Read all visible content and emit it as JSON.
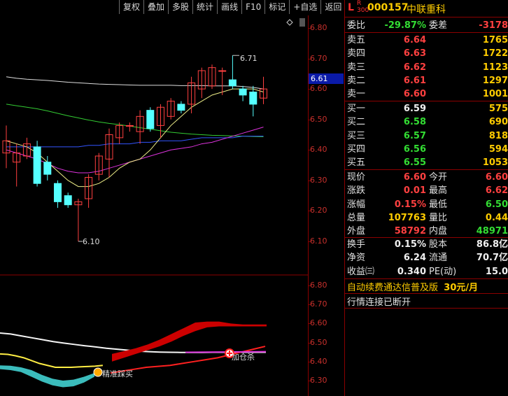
{
  "toolbar": [
    "复权",
    "叠加",
    "多股",
    "统计",
    "画线",
    "F10",
    "标记",
    "+自选",
    "返回"
  ],
  "chart_data": {
    "type": "candlestick",
    "price_ticks": [
      "6.80",
      "6.70",
      "6.60",
      "6.50",
      "6.40",
      "6.30",
      "6.20",
      "6.10"
    ],
    "sub_ticks": [
      "6.80",
      "6.70",
      "6.60",
      "6.50",
      "6.40",
      "6.30"
    ],
    "current_price_label": "6.61",
    "max_label": "6.71",
    "min_label": "6.10",
    "candles": [
      {
        "o": 6.39,
        "c": 6.43,
        "h": 6.48,
        "l": 6.34
      },
      {
        "o": 6.36,
        "c": 6.39,
        "h": 6.42,
        "l": 6.28
      },
      {
        "o": 6.38,
        "c": 6.42,
        "h": 6.44,
        "l": 6.37
      },
      {
        "o": 6.41,
        "c": 6.29,
        "h": 6.43,
        "l": 6.28
      },
      {
        "o": 6.36,
        "c": 6.32,
        "h": 6.38,
        "l": 6.3
      },
      {
        "o": 6.29,
        "c": 6.23,
        "h": 6.3,
        "l": 6.21
      },
      {
        "o": 6.25,
        "c": 6.22,
        "h": 6.26,
        "l": 6.21
      },
      {
        "o": 6.22,
        "c": 6.23,
        "h": 6.24,
        "l": 6.1
      },
      {
        "o": 6.24,
        "c": 6.31,
        "h": 6.32,
        "l": 6.21
      },
      {
        "o": 6.32,
        "c": 6.38,
        "h": 6.39,
        "l": 6.3
      },
      {
        "o": 6.37,
        "c": 6.45,
        "h": 6.47,
        "l": 6.31
      },
      {
        "o": 6.44,
        "c": 6.48,
        "h": 6.49,
        "l": 6.42
      },
      {
        "o": 6.48,
        "c": 6.48,
        "h": 6.49,
        "l": 6.46
      },
      {
        "o": 6.46,
        "c": 6.51,
        "h": 6.53,
        "l": 6.42
      },
      {
        "o": 6.53,
        "c": 6.47,
        "h": 6.54,
        "l": 6.46
      },
      {
        "o": 6.48,
        "c": 6.54,
        "h": 6.55,
        "l": 6.44
      },
      {
        "o": 6.51,
        "c": 6.56,
        "h": 6.57,
        "l": 6.5
      },
      {
        "o": 6.55,
        "c": 6.53,
        "h": 6.56,
        "l": 6.52
      },
      {
        "o": 6.55,
        "c": 6.62,
        "h": 6.64,
        "l": 6.52
      },
      {
        "o": 6.6,
        "c": 6.66,
        "h": 6.67,
        "l": 6.57
      },
      {
        "o": 6.61,
        "c": 6.67,
        "h": 6.68,
        "l": 6.6
      },
      {
        "o": 6.66,
        "c": 6.66,
        "h": 6.67,
        "l": 6.58
      },
      {
        "o": 6.63,
        "c": 6.61,
        "h": 6.71,
        "l": 6.6
      },
      {
        "o": 6.6,
        "c": 6.58,
        "h": 6.61,
        "l": 6.56
      },
      {
        "o": 6.59,
        "c": 6.55,
        "h": 6.61,
        "l": 6.51
      },
      {
        "o": 6.57,
        "c": 6.6,
        "h": 6.64,
        "l": 6.55
      }
    ],
    "ma_white": [
      6.64,
      6.635,
      6.632,
      6.63,
      6.628,
      6.625,
      6.622,
      6.62,
      6.618,
      6.616,
      6.615,
      6.614,
      6.613,
      6.612,
      6.612,
      6.612,
      6.612,
      6.611,
      6.611,
      6.611,
      6.61,
      6.61,
      6.61,
      6.608,
      6.605,
      6.6
    ],
    "ma_green": [
      6.55,
      6.545,
      6.54,
      6.535,
      6.528,
      6.52,
      6.512,
      6.505,
      6.498,
      6.492,
      6.487,
      6.483,
      6.478,
      6.473,
      6.468,
      6.463,
      6.458,
      6.455,
      6.452,
      6.45,
      6.448,
      6.447,
      6.446,
      6.445,
      6.444,
      6.443
    ],
    "ma_magenta": [
      6.4,
      6.39,
      6.38,
      6.37,
      6.355,
      6.34,
      6.33,
      6.325,
      6.325,
      6.33,
      6.34,
      6.35,
      6.36,
      6.37,
      6.38,
      6.39,
      6.4,
      6.405,
      6.41,
      6.42,
      6.425,
      6.435,
      6.445,
      6.455,
      6.465,
      6.475
    ],
    "ma_blue": [
      6.41,
      6.41,
      6.41,
      6.41,
      6.41,
      6.41,
      6.41,
      6.41,
      6.415,
      6.415,
      6.42,
      6.42,
      6.42,
      6.425,
      6.425,
      6.43,
      6.43,
      6.43,
      6.435,
      6.44,
      6.44,
      6.44,
      6.44,
      6.445,
      6.445,
      6.445
    ],
    "ma_yellow": [
      6.43,
      6.42,
      6.41,
      6.39,
      6.36,
      6.33,
      6.3,
      6.28,
      6.28,
      6.29,
      6.31,
      6.34,
      6.36,
      6.37,
      6.4,
      6.44,
      6.48,
      6.51,
      6.54,
      6.56,
      6.58,
      6.59,
      6.6,
      6.6,
      6.6,
      6.59
    ],
    "sub": {
      "white": [
        6.55,
        6.545,
        6.535,
        6.525,
        6.515,
        6.505,
        6.497,
        6.49,
        6.483,
        6.477,
        6.47,
        6.465,
        6.46,
        6.455,
        6.452,
        6.45,
        6.449,
        6.448,
        6.448,
        6.448,
        6.449,
        6.449,
        6.449,
        6.449,
        6.449,
        6.449
      ],
      "yellow": [
        6.44,
        6.438,
        6.43,
        6.42,
        6.405,
        6.39,
        6.38,
        6.37,
        6.37,
        6.37,
        6.372,
        6.374,
        6.376,
        6.38
      ],
      "cyan_top": [
        6.38,
        6.378,
        6.37,
        6.355,
        6.33,
        6.31,
        6.3,
        6.305,
        6.32,
        6.34
      ],
      "cyan_bot": [
        6.36,
        6.355,
        6.345,
        6.32,
        6.295,
        6.275,
        6.265,
        6.27,
        6.29,
        6.32
      ],
      "red_lower": [
        6.34,
        6.35,
        6.36,
        6.37,
        6.375,
        6.38,
        6.39,
        6.4,
        6.41,
        6.42,
        6.435,
        6.45,
        6.465,
        6.48
      ],
      "band_top": [
        6.44,
        6.455,
        6.47,
        6.49,
        6.515,
        6.545,
        6.575,
        6.605,
        6.61,
        6.61,
        6.6,
        6.595,
        6.595,
        6.595
      ],
      "band_bot": [
        6.4,
        6.42,
        6.44,
        6.46,
        6.48,
        6.505,
        6.535,
        6.56,
        6.58,
        6.585,
        6.585,
        6.585,
        6.585,
        6.585
      ]
    },
    "annotations": {
      "buy": "精准踩买",
      "add": "加仓杀"
    }
  },
  "panel": {
    "l": "L",
    "r": "R",
    "r2": "300",
    "code": "000157",
    "name": "中联重科",
    "wei": {
      "lab": "委比",
      "val": "-29.87%",
      "lab2": "委差",
      "val2": "-3178"
    },
    "asks": [
      {
        "lab": "卖五",
        "price": "6.64",
        "vol": "1765"
      },
      {
        "lab": "卖四",
        "price": "6.63",
        "vol": "1722"
      },
      {
        "lab": "卖三",
        "price": "6.62",
        "vol": "1123"
      },
      {
        "lab": "卖二",
        "price": "6.61",
        "vol": "1297"
      },
      {
        "lab": "卖一",
        "price": "6.60",
        "vol": "1001"
      }
    ],
    "bids": [
      {
        "lab": "买一",
        "price": "6.59",
        "vol": "575"
      },
      {
        "lab": "买二",
        "price": "6.58",
        "vol": "690"
      },
      {
        "lab": "买三",
        "price": "6.57",
        "vol": "818"
      },
      {
        "lab": "买四",
        "price": "6.56",
        "vol": "594"
      },
      {
        "lab": "买五",
        "price": "6.55",
        "vol": "1053"
      }
    ],
    "stats": [
      {
        "lab": "现价",
        "val": "6.60",
        "c1": "red",
        "lab2": "今开",
        "val2": "6.60",
        "c2": "red"
      },
      {
        "lab": "涨跌",
        "val": "0.01",
        "c1": "red",
        "lab2": "最高",
        "val2": "6.62",
        "c2": "red"
      },
      {
        "lab": "涨幅",
        "val": "0.15%",
        "c1": "red",
        "lab2": "最低",
        "val2": "6.50",
        "c2": "green"
      },
      {
        "lab": "总量",
        "val": "107763",
        "c1": "yellow",
        "lab2": "量比",
        "val2": "0.44",
        "c2": "yellow"
      },
      {
        "lab": "外盘",
        "val": "58792",
        "c1": "red",
        "lab2": "内盘",
        "val2": "48971",
        "c2": "green"
      }
    ],
    "fund": [
      {
        "lab": "换手",
        "val": "0.15%",
        "lab2": "股本",
        "val2": "86.8亿"
      },
      {
        "lab": "净资",
        "val": "6.24",
        "lab2": "流通",
        "val2": "70.7亿"
      },
      {
        "lab": "收益㈢",
        "val": "0.340",
        "lab2": "PE(动)",
        "val2": "15.0"
      }
    ],
    "ad_text": "自动续费通达信普及版",
    "ad_price": "30元/月",
    "conn_status": "行情连接已断开"
  },
  "colors": {
    "up": "#ff4040",
    "down": "#55ffff",
    "bg": "#000000",
    "grid": "#8b0000"
  }
}
